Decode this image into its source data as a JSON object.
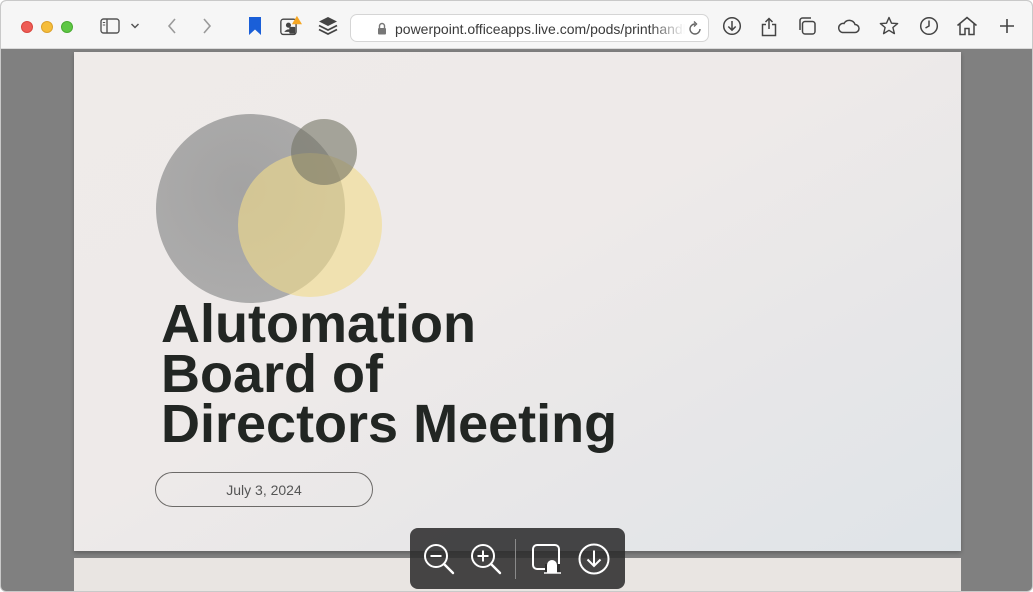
{
  "browser": {
    "url": "powerpoint.officeapps.live.com/pods/printhandler",
    "icons": [
      "sidebar-icon",
      "chevron-down-icon",
      "back-icon",
      "forward-icon",
      "bookmark-icon",
      "extension-alert-icon",
      "layers-icon",
      "lock-icon",
      "reload-icon",
      "download-icon",
      "share-icon",
      "tabs-icon",
      "cloud-icon",
      "star-icon",
      "history-icon",
      "home-icon",
      "new-tab-icon"
    ],
    "colors": {
      "bookmark": "#1a5fd8",
      "alert": "#f5a623"
    }
  },
  "slide": {
    "title_lines": [
      "Alutomation",
      "Board of",
      "Directors Meeting"
    ],
    "date": "July 3, 2024",
    "colors": {
      "title": "#222623",
      "gray_circle": "#9a9a9a",
      "yellow_circle": "#f0dc8c",
      "olive_circle": "#737364"
    }
  },
  "viewer_controls": {
    "icons": [
      "zoom-out-icon",
      "zoom-in-icon",
      "fit-page-icon",
      "download-icon"
    ]
  }
}
